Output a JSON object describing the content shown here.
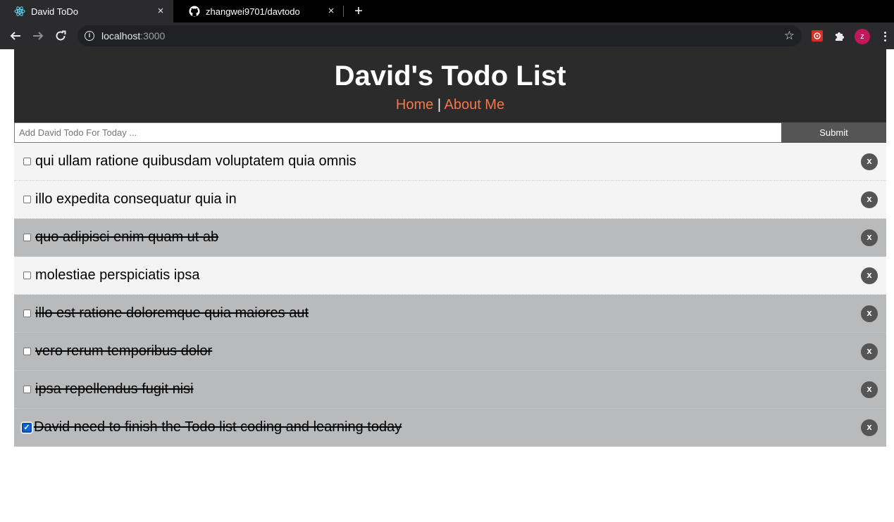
{
  "browser": {
    "tabs": [
      {
        "title": "David ToDo",
        "close": "×"
      },
      {
        "title": "zhangwei9701/davtodo",
        "close": "×"
      }
    ],
    "new_tab": "+",
    "url_host": "localhost",
    "url_port": ":3000",
    "profile_initial": "z"
  },
  "header": {
    "title": "David's Todo List",
    "nav_home": "Home",
    "nav_separator": " | ",
    "nav_about": "About Me"
  },
  "form": {
    "placeholder": "Add David Todo For Today ...",
    "submit_label": "Submit"
  },
  "todos": [
    {
      "title": "qui ullam ratione quibusdam voluptatem quia omnis",
      "completed": false,
      "delete_label": "x"
    },
    {
      "title": "illo expedita consequatur quia in",
      "completed": false,
      "delete_label": "x"
    },
    {
      "title": "quo adipisci enim quam ut ab",
      "completed": true,
      "delete_label": "x"
    },
    {
      "title": "molestiae perspiciatis ipsa",
      "completed": false,
      "delete_label": "x"
    },
    {
      "title": "illo est ratione doloremque quia maiores aut",
      "completed": true,
      "delete_label": "x"
    },
    {
      "title": "vero rerum temporibus dolor",
      "completed": true,
      "delete_label": "x"
    },
    {
      "title": "ipsa repellendus fugit nisi",
      "completed": true,
      "delete_label": "x"
    },
    {
      "title": "David need to finish the Todo list coding and learning today",
      "completed": true,
      "checkbox_checked": true,
      "delete_label": "x"
    }
  ],
  "colors": {
    "header_bg": "#2b2b2b",
    "nav_link": "#f2784b",
    "todo_bg": "#f4f4f4",
    "todo_done_bg": "#b9babc",
    "button_bg": "#555555"
  }
}
